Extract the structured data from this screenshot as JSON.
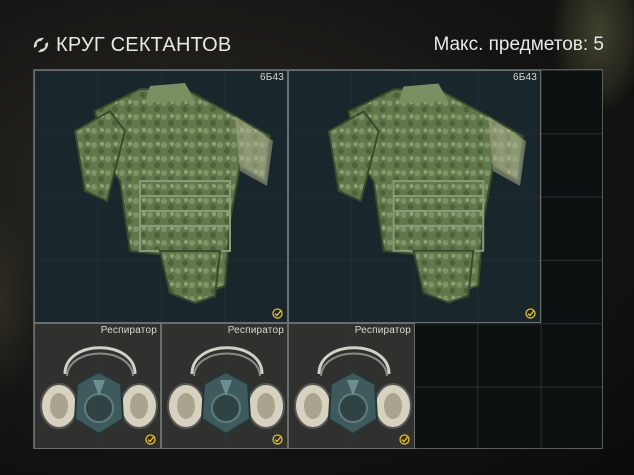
{
  "header": {
    "title": "КРУГ СЕКТАНТОВ",
    "max_items": "Макс. предметов: 5"
  },
  "items": [
    {
      "label": "6Б43"
    },
    {
      "label": "6Б43"
    },
    {
      "label": "Респиратор"
    },
    {
      "label": "Респиратор"
    },
    {
      "label": "Респиратор"
    }
  ],
  "colors": {
    "armor_green": "#5f7a4a",
    "check_yellow": "#e3c13a"
  }
}
